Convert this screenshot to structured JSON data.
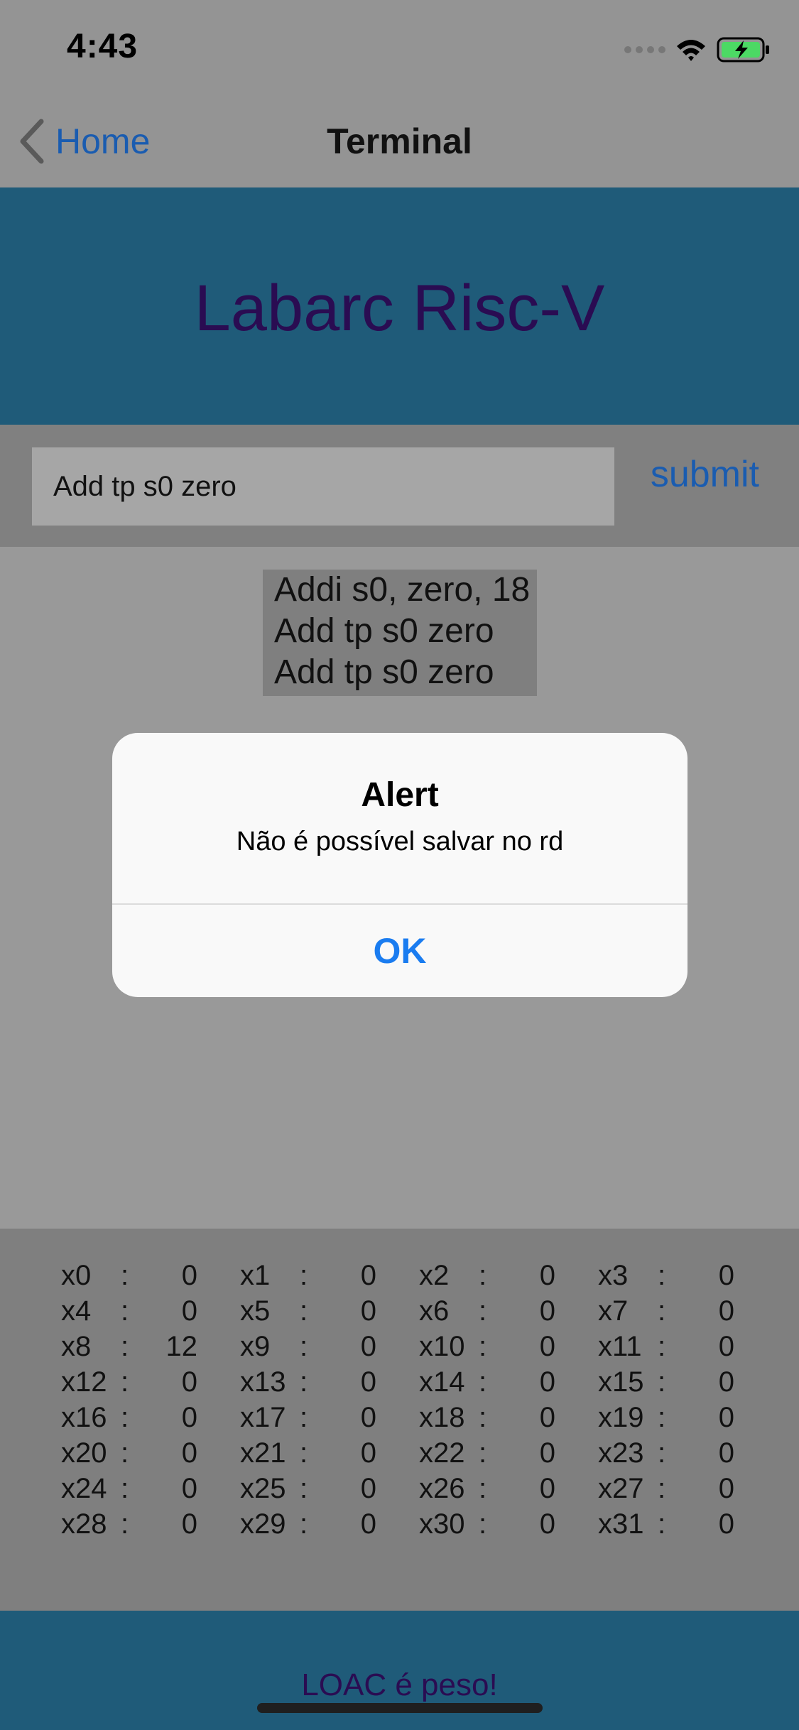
{
  "status_bar": {
    "time": "4:43",
    "icons": [
      "signal-dots-icon",
      "wifi-icon",
      "battery-charging-icon"
    ]
  },
  "nav": {
    "back_label": "Home",
    "title": "Terminal"
  },
  "header": {
    "app_title": "Labarc Risc-V"
  },
  "input": {
    "value": "Add tp s0 zero",
    "submit_label": "submit"
  },
  "history": [
    "Addi s0, zero, 18",
    "Add tp s0 zero",
    "Add tp s0 zero"
  ],
  "registers": [
    {
      "name": "x0",
      "value": "0"
    },
    {
      "name": "x1",
      "value": "0"
    },
    {
      "name": "x2",
      "value": "0"
    },
    {
      "name": "x3",
      "value": "0"
    },
    {
      "name": "x4",
      "value": "0"
    },
    {
      "name": "x5",
      "value": "0"
    },
    {
      "name": "x6",
      "value": "0"
    },
    {
      "name": "x7",
      "value": "0"
    },
    {
      "name": "x8",
      "value": "12"
    },
    {
      "name": "x9",
      "value": "0"
    },
    {
      "name": "x10",
      "value": "0"
    },
    {
      "name": "x11",
      "value": "0"
    },
    {
      "name": "x12",
      "value": "0"
    },
    {
      "name": "x13",
      "value": "0"
    },
    {
      "name": "x14",
      "value": "0"
    },
    {
      "name": "x15",
      "value": "0"
    },
    {
      "name": "x16",
      "value": "0"
    },
    {
      "name": "x17",
      "value": "0"
    },
    {
      "name": "x18",
      "value": "0"
    },
    {
      "name": "x19",
      "value": "0"
    },
    {
      "name": "x20",
      "value": "0"
    },
    {
      "name": "x21",
      "value": "0"
    },
    {
      "name": "x22",
      "value": "0"
    },
    {
      "name": "x23",
      "value": "0"
    },
    {
      "name": "x24",
      "value": "0"
    },
    {
      "name": "x25",
      "value": "0"
    },
    {
      "name": "x26",
      "value": "0"
    },
    {
      "name": "x27",
      "value": "0"
    },
    {
      "name": "x28",
      "value": "0"
    },
    {
      "name": "x29",
      "value": "0"
    },
    {
      "name": "x30",
      "value": "0"
    },
    {
      "name": "x31",
      "value": "0"
    }
  ],
  "register_separator": ":",
  "footer": {
    "text": "LOAC é peso!"
  },
  "alert": {
    "title": "Alert",
    "message": "Não é possível salvar no rd",
    "ok_label": "OK"
  },
  "colors": {
    "header_band": "#1f5b79",
    "title_text": "#2a0c52",
    "link_blue": "#1a5cb0",
    "alert_button": "#1a7cf0",
    "battery_green": "#4cd964"
  }
}
